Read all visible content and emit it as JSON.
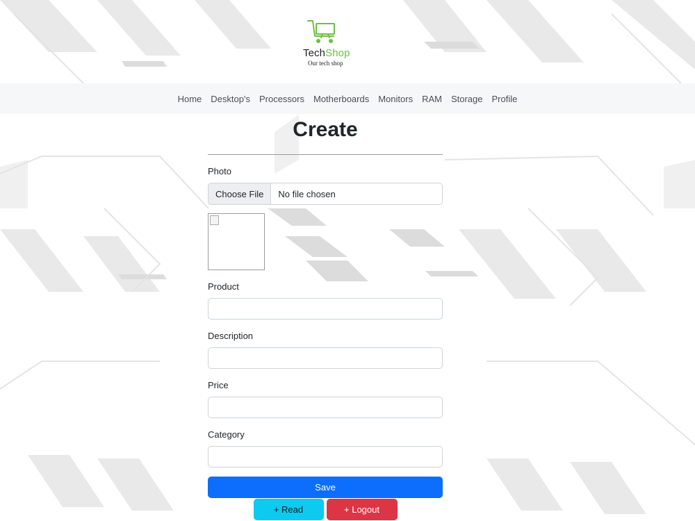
{
  "brand": {
    "name_part1": "Tech",
    "name_part2": "Shop",
    "tagline": "Our tech shop",
    "logo_icon": "shopping-cart-monitor-icon",
    "logo_color": "#6abf40"
  },
  "nav": {
    "items": [
      "Home",
      "Desktop's",
      "Processors",
      "Motherboards",
      "Monitors",
      "RAM",
      "Storage",
      "Profile"
    ]
  },
  "form": {
    "title": "Create",
    "photo_label": "Photo",
    "file_button": "Choose File",
    "file_status": "No file chosen",
    "product_label": "Product",
    "product_value": "",
    "description_label": "Description",
    "description_value": "",
    "price_label": "Price",
    "price_value": "",
    "category_label": "Category",
    "category_value": "",
    "save_label": "Save",
    "read_label": "+ Read",
    "logout_label": "+ Logout"
  },
  "colors": {
    "primary": "#0d6efd",
    "info": "#0dcaf0",
    "danger": "#dc3545",
    "navbar": "#f6f7f8"
  }
}
